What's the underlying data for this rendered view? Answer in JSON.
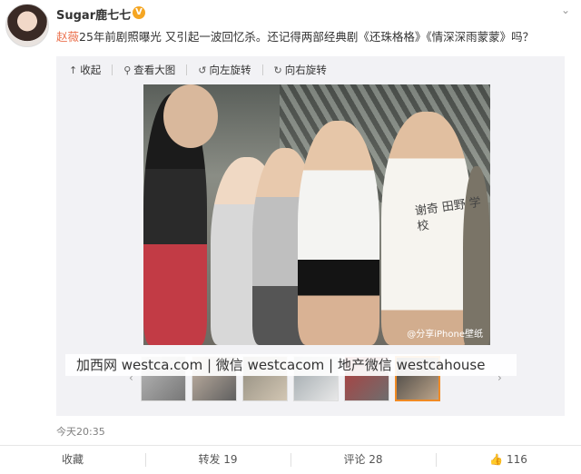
{
  "post": {
    "username": "Sugar鹿七七",
    "verified_badge": "V",
    "mention": "赵薇",
    "text": "25年前剧照曝光 又引起一波回忆杀。还记得两部经典剧《还珠格格》《情深深雨蒙蒙》吗？",
    "more_icon": "chevron-down-icon"
  },
  "toolbar": {
    "collapse": "收起",
    "view_large": "查看大图",
    "rotate_left": "向左旋转",
    "rotate_right": "向右旋转"
  },
  "photo": {
    "watermark": "@分享iPhone壁纸",
    "shirt_text": "谢奇 田野 学校"
  },
  "banner": {
    "text": "加西网 westca.com | 微信 westcacom | 地产微信 westcahouse"
  },
  "thumbnails": {
    "count": 6,
    "active_index": 5
  },
  "meta": {
    "timestamp": "今天20:35"
  },
  "actions": {
    "favorite": "收藏",
    "repost": "转发 19",
    "comment": "评论 28",
    "like": "116"
  },
  "colors": {
    "mention": "#eb7350",
    "verified": "#f5a623",
    "active_thumb_border": "#f08a24",
    "panel_bg": "#f2f2f5"
  }
}
